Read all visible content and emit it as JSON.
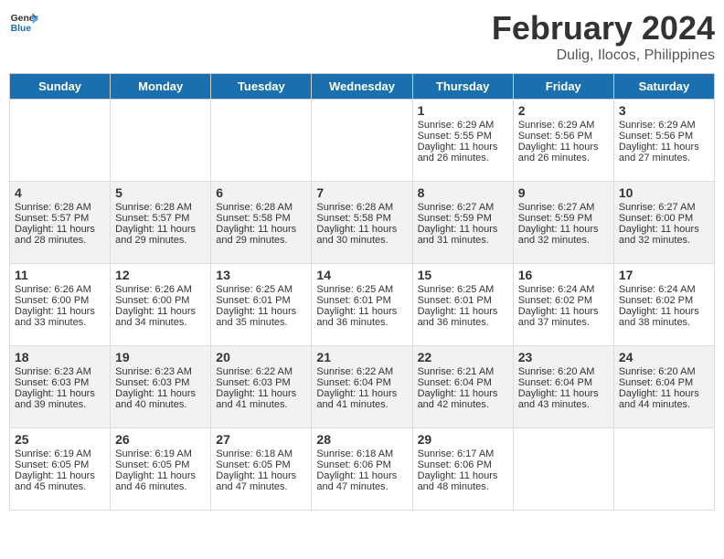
{
  "app": {
    "logo_text_general": "General",
    "logo_text_blue": "Blue",
    "main_title": "February 2024",
    "subtitle": "Dulig, Ilocos, Philippines"
  },
  "calendar": {
    "headers": [
      "Sunday",
      "Monday",
      "Tuesday",
      "Wednesday",
      "Thursday",
      "Friday",
      "Saturday"
    ],
    "weeks": [
      [
        {
          "date": "",
          "sunrise": "",
          "sunset": "",
          "daylight": ""
        },
        {
          "date": "",
          "sunrise": "",
          "sunset": "",
          "daylight": ""
        },
        {
          "date": "",
          "sunrise": "",
          "sunset": "",
          "daylight": ""
        },
        {
          "date": "",
          "sunrise": "",
          "sunset": "",
          "daylight": ""
        },
        {
          "date": "1",
          "sunrise": "Sunrise: 6:29 AM",
          "sunset": "Sunset: 5:55 PM",
          "daylight": "Daylight: 11 hours and 26 minutes."
        },
        {
          "date": "2",
          "sunrise": "Sunrise: 6:29 AM",
          "sunset": "Sunset: 5:56 PM",
          "daylight": "Daylight: 11 hours and 26 minutes."
        },
        {
          "date": "3",
          "sunrise": "Sunrise: 6:29 AM",
          "sunset": "Sunset: 5:56 PM",
          "daylight": "Daylight: 11 hours and 27 minutes."
        }
      ],
      [
        {
          "date": "4",
          "sunrise": "Sunrise: 6:28 AM",
          "sunset": "Sunset: 5:57 PM",
          "daylight": "Daylight: 11 hours and 28 minutes."
        },
        {
          "date": "5",
          "sunrise": "Sunrise: 6:28 AM",
          "sunset": "Sunset: 5:57 PM",
          "daylight": "Daylight: 11 hours and 29 minutes."
        },
        {
          "date": "6",
          "sunrise": "Sunrise: 6:28 AM",
          "sunset": "Sunset: 5:58 PM",
          "daylight": "Daylight: 11 hours and 29 minutes."
        },
        {
          "date": "7",
          "sunrise": "Sunrise: 6:28 AM",
          "sunset": "Sunset: 5:58 PM",
          "daylight": "Daylight: 11 hours and 30 minutes."
        },
        {
          "date": "8",
          "sunrise": "Sunrise: 6:27 AM",
          "sunset": "Sunset: 5:59 PM",
          "daylight": "Daylight: 11 hours and 31 minutes."
        },
        {
          "date": "9",
          "sunrise": "Sunrise: 6:27 AM",
          "sunset": "Sunset: 5:59 PM",
          "daylight": "Daylight: 11 hours and 32 minutes."
        },
        {
          "date": "10",
          "sunrise": "Sunrise: 6:27 AM",
          "sunset": "Sunset: 6:00 PM",
          "daylight": "Daylight: 11 hours and 32 minutes."
        }
      ],
      [
        {
          "date": "11",
          "sunrise": "Sunrise: 6:26 AM",
          "sunset": "Sunset: 6:00 PM",
          "daylight": "Daylight: 11 hours and 33 minutes."
        },
        {
          "date": "12",
          "sunrise": "Sunrise: 6:26 AM",
          "sunset": "Sunset: 6:00 PM",
          "daylight": "Daylight: 11 hours and 34 minutes."
        },
        {
          "date": "13",
          "sunrise": "Sunrise: 6:25 AM",
          "sunset": "Sunset: 6:01 PM",
          "daylight": "Daylight: 11 hours and 35 minutes."
        },
        {
          "date": "14",
          "sunrise": "Sunrise: 6:25 AM",
          "sunset": "Sunset: 6:01 PM",
          "daylight": "Daylight: 11 hours and 36 minutes."
        },
        {
          "date": "15",
          "sunrise": "Sunrise: 6:25 AM",
          "sunset": "Sunset: 6:01 PM",
          "daylight": "Daylight: 11 hours and 36 minutes."
        },
        {
          "date": "16",
          "sunrise": "Sunrise: 6:24 AM",
          "sunset": "Sunset: 6:02 PM",
          "daylight": "Daylight: 11 hours and 37 minutes."
        },
        {
          "date": "17",
          "sunrise": "Sunrise: 6:24 AM",
          "sunset": "Sunset: 6:02 PM",
          "daylight": "Daylight: 11 hours and 38 minutes."
        }
      ],
      [
        {
          "date": "18",
          "sunrise": "Sunrise: 6:23 AM",
          "sunset": "Sunset: 6:03 PM",
          "daylight": "Daylight: 11 hours and 39 minutes."
        },
        {
          "date": "19",
          "sunrise": "Sunrise: 6:23 AM",
          "sunset": "Sunset: 6:03 PM",
          "daylight": "Daylight: 11 hours and 40 minutes."
        },
        {
          "date": "20",
          "sunrise": "Sunrise: 6:22 AM",
          "sunset": "Sunset: 6:03 PM",
          "daylight": "Daylight: 11 hours and 41 minutes."
        },
        {
          "date": "21",
          "sunrise": "Sunrise: 6:22 AM",
          "sunset": "Sunset: 6:04 PM",
          "daylight": "Daylight: 11 hours and 41 minutes."
        },
        {
          "date": "22",
          "sunrise": "Sunrise: 6:21 AM",
          "sunset": "Sunset: 6:04 PM",
          "daylight": "Daylight: 11 hours and 42 minutes."
        },
        {
          "date": "23",
          "sunrise": "Sunrise: 6:20 AM",
          "sunset": "Sunset: 6:04 PM",
          "daylight": "Daylight: 11 hours and 43 minutes."
        },
        {
          "date": "24",
          "sunrise": "Sunrise: 6:20 AM",
          "sunset": "Sunset: 6:04 PM",
          "daylight": "Daylight: 11 hours and 44 minutes."
        }
      ],
      [
        {
          "date": "25",
          "sunrise": "Sunrise: 6:19 AM",
          "sunset": "Sunset: 6:05 PM",
          "daylight": "Daylight: 11 hours and 45 minutes."
        },
        {
          "date": "26",
          "sunrise": "Sunrise: 6:19 AM",
          "sunset": "Sunset: 6:05 PM",
          "daylight": "Daylight: 11 hours and 46 minutes."
        },
        {
          "date": "27",
          "sunrise": "Sunrise: 6:18 AM",
          "sunset": "Sunset: 6:05 PM",
          "daylight": "Daylight: 11 hours and 47 minutes."
        },
        {
          "date": "28",
          "sunrise": "Sunrise: 6:18 AM",
          "sunset": "Sunset: 6:06 PM",
          "daylight": "Daylight: 11 hours and 47 minutes."
        },
        {
          "date": "29",
          "sunrise": "Sunrise: 6:17 AM",
          "sunset": "Sunset: 6:06 PM",
          "daylight": "Daylight: 11 hours and 48 minutes."
        },
        {
          "date": "",
          "sunrise": "",
          "sunset": "",
          "daylight": ""
        },
        {
          "date": "",
          "sunrise": "",
          "sunset": "",
          "daylight": ""
        }
      ]
    ]
  }
}
